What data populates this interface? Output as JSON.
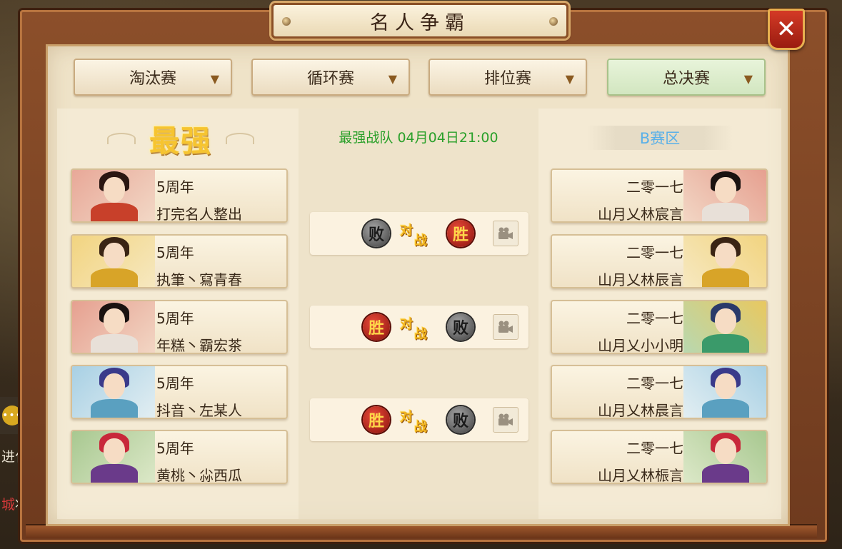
{
  "window": {
    "title": "名人争霸",
    "close_label": "✕"
  },
  "tabs": [
    {
      "label": "淘汰赛",
      "active": false
    },
    {
      "label": "循环赛",
      "active": false
    },
    {
      "label": "排位赛",
      "active": false
    },
    {
      "label": "总决赛",
      "active": true
    }
  ],
  "headers": {
    "left": "最强",
    "middle": "最强战队 04月04日21:00",
    "right": "B赛区"
  },
  "left_players": [
    {
      "line1": "5周年",
      "line2": "打完名人整出",
      "portrait": "female-red-hair"
    },
    {
      "line1": "5周年",
      "line2": "执筆丶寫青春",
      "portrait": "male-gold-armor"
    },
    {
      "line1": "5周年",
      "line2": "年糕丶霸宏茶",
      "portrait": "male-red"
    },
    {
      "line1": "5周年",
      "line2": "抖音丶左某人",
      "portrait": "male-blue"
    },
    {
      "line1": "5周年",
      "line2": "黄桃丶尛西瓜",
      "portrait": "female-purple"
    }
  ],
  "right_players": [
    {
      "line1": "二零一七",
      "line2": "山月乂林宸言",
      "portrait": "male-red"
    },
    {
      "line1": "二零一七",
      "line2": "山月乂林辰言",
      "portrait": "male-gold-armor"
    },
    {
      "line1": "二零一七",
      "line2": "山月乂小小明",
      "portrait": "male-blue-green"
    },
    {
      "line1": "二零一七",
      "line2": "山月乂林晨言",
      "portrait": "male-blue"
    },
    {
      "line1": "二零一七",
      "line2": "山月乂林桭言",
      "portrait": "female-purple"
    }
  ],
  "matches": [
    {
      "left_result": "败",
      "vs_1": "对",
      "vs_2": "战",
      "right_result": "胜",
      "left_win": false
    },
    {
      "left_result": "胜",
      "vs_1": "对",
      "vs_2": "战",
      "right_result": "败",
      "left_win": true
    },
    {
      "left_result": "胜",
      "vs_1": "对",
      "vs_2": "战",
      "right_result": "败",
      "left_win": true
    }
  ],
  "background": {
    "chat_icon": "chat-bubble-icon",
    "text_1": "进化过",
    "text_2_red": "城",
    "text_2": "将"
  },
  "colors": {
    "frame": "#8c4f2a",
    "panel": "#efe3c8",
    "win": "#c8281a",
    "lose": "#5a5a5a",
    "header_gold": "#f6c430",
    "header_green": "#2aa02a",
    "header_blue": "#5ab0e8"
  }
}
